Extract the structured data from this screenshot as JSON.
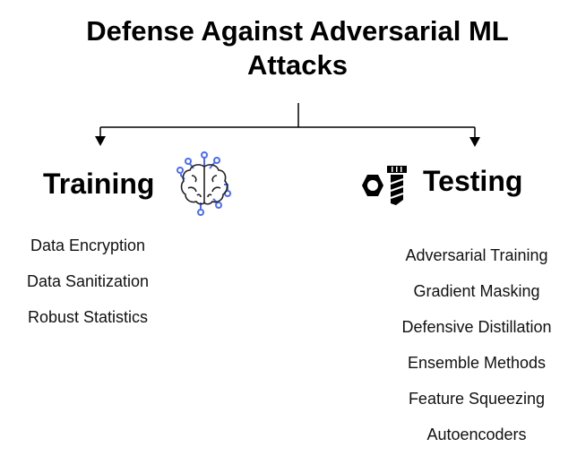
{
  "title": "Defense Against Adversarial ML Attacks",
  "title_line1": "Defense Against Adversarial ML",
  "title_line2": "Attacks",
  "colors": {
    "brain_accent": "#4a6cf7",
    "text": "#000000"
  },
  "branches": {
    "training": {
      "label": "Training",
      "icon": "brain-circuit-icon",
      "items": [
        "Data Encryption",
        "Data Sanitization",
        "Robust Statistics"
      ]
    },
    "testing": {
      "label": "Testing",
      "icon": "nut-bolt-icon",
      "items": [
        "Adversarial Training",
        "Gradient Masking",
        "Defensive Distillation",
        "Ensemble Methods",
        "Feature Squeezing",
        "Autoencoders"
      ]
    }
  }
}
